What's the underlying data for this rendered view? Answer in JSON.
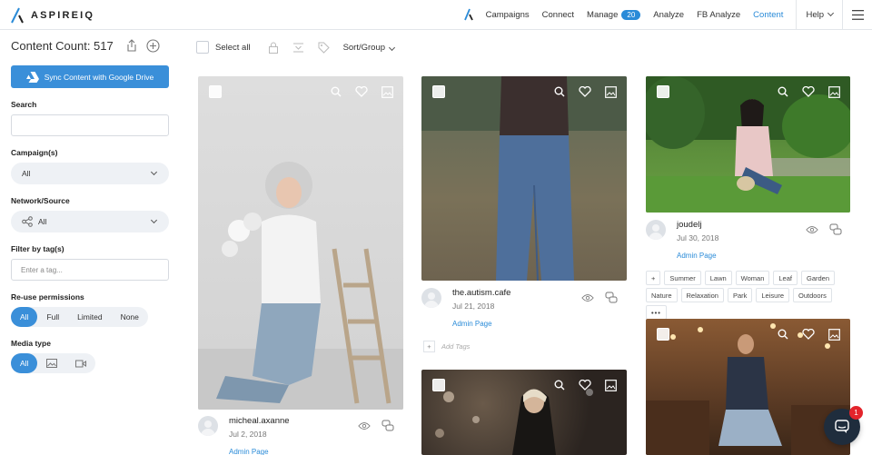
{
  "brand": {
    "name": "ASPIREIQ",
    "accent": "#2a8bd8"
  },
  "nav": {
    "items": [
      {
        "label": "Campaigns"
      },
      {
        "label": "Connect"
      },
      {
        "label": "Manage",
        "badge": "20"
      },
      {
        "label": "Analyze"
      },
      {
        "label": "FB Analyze"
      },
      {
        "label": "Content",
        "active": true
      }
    ],
    "help": "Help"
  },
  "sidebar": {
    "title": "Content Count: 517",
    "sync_button": "Sync Content with Google Drive",
    "search_label": "Search",
    "campaigns_label": "Campaign(s)",
    "campaigns_value": "All",
    "network_label": "Network/Source",
    "network_value": "All",
    "tag_label": "Filter by tag(s)",
    "tag_placeholder": "Enter a tag...",
    "reuse_label": "Re-use permissions",
    "reuse_options": [
      "All",
      "Full",
      "Limited",
      "None"
    ],
    "media_label": "Media type",
    "media_options": [
      "All"
    ]
  },
  "toolbar": {
    "select_all": "Select all",
    "sort": "Sort/Group"
  },
  "cards": [
    {
      "user": "micheal.axanne",
      "date": "Jul 2, 2018",
      "link": "Admin Page"
    },
    {
      "user": "the.autism.cafe",
      "date": "Jul 21, 2018",
      "link": "Admin Page",
      "add_tags": "Add Tags"
    },
    {
      "user": "joudelj",
      "date": "Jul 30, 2018",
      "link": "Admin Page",
      "tags": [
        "Summer",
        "Lawn",
        "Woman",
        "Leaf",
        "Garden",
        "Nature",
        "Relaxation",
        "Park",
        "Leisure",
        "Outdoors"
      ]
    }
  ],
  "chat": {
    "badge": "1"
  }
}
